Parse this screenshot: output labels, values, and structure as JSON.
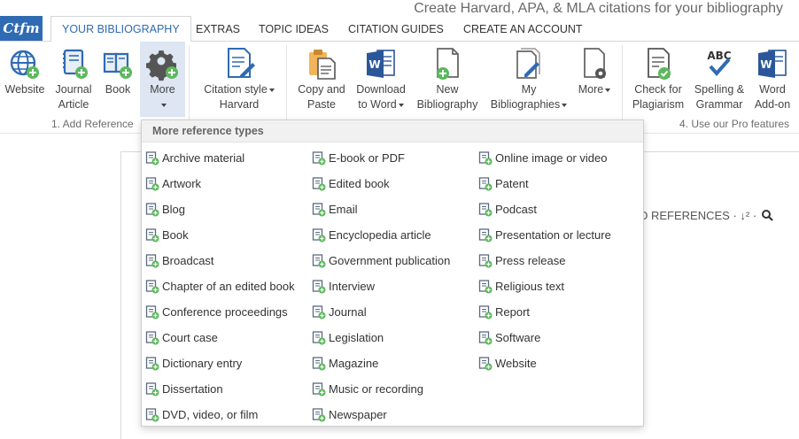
{
  "logo": {
    "text": "Ctfm"
  },
  "headline": "Create Harvard, APA, & MLA citations for your bibliography",
  "tabs": [
    {
      "label": "YOUR BIBLIOGRAPHY",
      "active": true
    },
    {
      "label": "EXTRAS",
      "active": false
    },
    {
      "label": "TOPIC IDEAS",
      "active": false
    },
    {
      "label": "CITATION GUIDES",
      "active": false
    },
    {
      "label": "CREATE AN ACCOUNT",
      "active": false
    }
  ],
  "ribbon": {
    "add_reference": {
      "website": "Website",
      "journal_line1": "Journal",
      "journal_line2": "Article",
      "book": "Book",
      "more": "More",
      "group_label": "1. Add Reference"
    },
    "citation_style": {
      "line1": "Citation style",
      "line2": "Harvard"
    },
    "copy_paste": {
      "line1": "Copy and",
      "line2": "Paste"
    },
    "download": {
      "line1": "Download",
      "line2": "to Word"
    },
    "new_bib": {
      "line1": "New",
      "line2": "Bibliography"
    },
    "my_bibs": {
      "line1": "My",
      "line2": "Bibliographies"
    },
    "more2": "More",
    "plagiarism": {
      "line1": "Check for",
      "line2": "Plagiarism"
    },
    "spelling": {
      "line1": "Spelling &",
      "line2": "Grammar",
      "icon_text": "ABC"
    },
    "word_addon": {
      "line1": "Word",
      "line2": "Add-on"
    },
    "pro_label": "4. Use our Pro features"
  },
  "refs_bar": "D REFERENCES · ↓² ·",
  "dropdown": {
    "header": "More reference types",
    "col1": [
      "Archive material",
      "Artwork",
      "Blog",
      "Book",
      "Broadcast",
      "Chapter of an edited book",
      "Conference proceedings",
      "Court case",
      "Dictionary entry",
      "Dissertation",
      "DVD, video, or film"
    ],
    "col2": [
      "E-book or PDF",
      "Edited book",
      "Email",
      "Encyclopedia article",
      "Government publication",
      "Interview",
      "Journal",
      "Legislation",
      "Magazine",
      "Music or recording",
      "Newspaper"
    ],
    "col3": [
      "Online image or video",
      "Patent",
      "Podcast",
      "Presentation or lecture",
      "Press release",
      "Religious text",
      "Report",
      "Software",
      "Website"
    ]
  },
  "colors": {
    "brand_blue": "#2f6bb3",
    "add_green": "#5cb85c",
    "selected_bg": "#dde6f2"
  }
}
